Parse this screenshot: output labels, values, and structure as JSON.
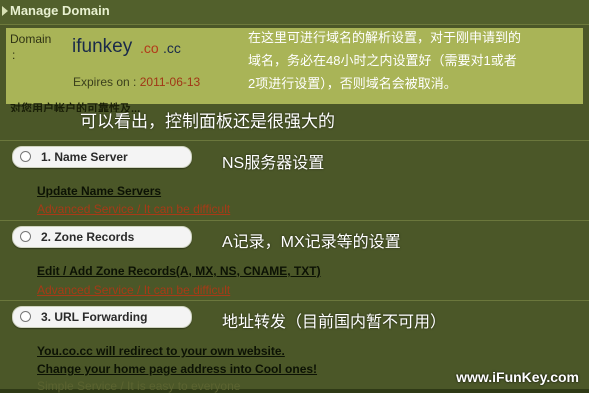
{
  "header": {
    "title": "Manage Domain"
  },
  "domain_info": {
    "label": "Domain",
    "colon": ":",
    "name_main": "ifunkey",
    "name_tld": ".co",
    "name_cc": ".cc",
    "expires_label": "Expires on :",
    "expires_date": "2011-06-13"
  },
  "notice_text": "对您用户帐户的可靠性及...",
  "note": {
    "lines": [
      "在这里可进行域名的解析设置，对于刚申请到的",
      "域名，务必在48小时之内设置好（需要对1或者",
      "2项进行设置），否则域名会被取消。"
    ]
  },
  "captions": {
    "panel_strong": "可以看出，控制面板还是很强大的",
    "ns": "NS服务器设置",
    "records": "A记录，MX记录等的设置",
    "forwarding": "地址转发（目前国内暂不可用）"
  },
  "sections": [
    {
      "pill": "1. Name Server",
      "link": "Update Name Servers",
      "service": "Advanced Service / It can be difficult"
    },
    {
      "pill": "2. Zone Records",
      "link": "Edit / Add Zone Records(A, MX, NS, CNAME, TXT)",
      "service": "Advanced Service / It can be difficult"
    },
    {
      "pill": "3. URL Forwarding",
      "link1": "You.co.cc will redirect to your own website.",
      "link2": "Change your home page address into Cool ones!",
      "service": "Simple Service / It is easy to everyone"
    }
  ],
  "site_tag": "www.iFunKey.com"
}
